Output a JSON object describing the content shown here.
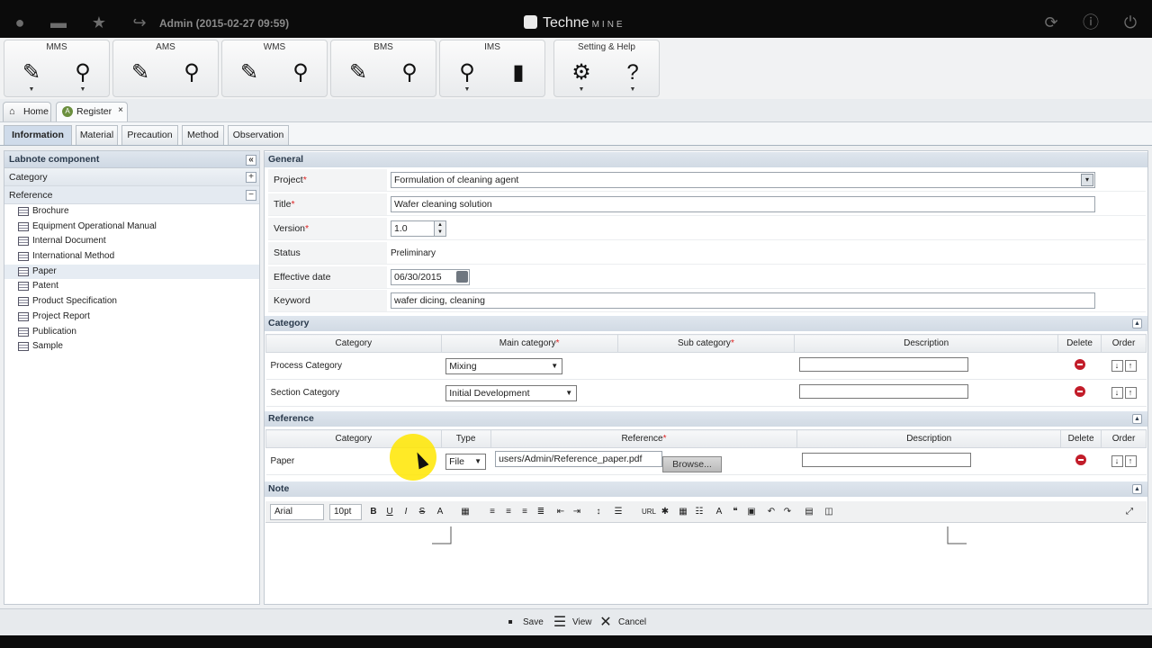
{
  "topbar": {
    "user_title": "Admin (2015-02-27 09:59)",
    "brand": "Techne",
    "brand_suffix": "MINE"
  },
  "modules": [
    {
      "title": "MMS"
    },
    {
      "title": "AMS"
    },
    {
      "title": "WMS"
    },
    {
      "title": "BMS"
    },
    {
      "title": "IMS"
    },
    {
      "title": "Setting & Help"
    }
  ],
  "page_tabs": {
    "home": "Home",
    "register": "Register"
  },
  "sub_tabs": {
    "information": "Information",
    "material": "Material",
    "precaution": "Precaution",
    "method": "Method",
    "observation": "Observation"
  },
  "left": {
    "header": "Labnote component",
    "category": "Category",
    "reference": "Reference",
    "items": [
      "Brochure",
      "Equipment Operational Manual",
      "Internal Document",
      "International Method",
      "Paper",
      "Patent",
      "Product Specification",
      "Project Report",
      "Publication",
      "Sample"
    ]
  },
  "general": {
    "header": "General",
    "project_label": "Project",
    "project_value": "Formulation of cleaning agent",
    "title_label": "Title",
    "title_value": "Wafer cleaning solution",
    "version_label": "Version",
    "version_value": "1.0",
    "status_label": "Status",
    "status_value": "Preliminary",
    "date_label": "Effective date",
    "date_value": "06/30/2015",
    "keyword_label": "Keyword",
    "keyword_value": "wafer dicing, cleaning",
    "req": "*"
  },
  "category": {
    "header": "Category",
    "columns": {
      "category": "Category",
      "main": "Main category",
      "sub": "Sub category",
      "description": "Description",
      "delete": "Delete",
      "order": "Order"
    },
    "rows": [
      {
        "category": "Process Category",
        "main": "Mixing"
      },
      {
        "category": "Section Category",
        "main": "Initial Development"
      }
    ]
  },
  "reference": {
    "header": "Reference",
    "columns": {
      "category": "Category",
      "type": "Type",
      "reference": "Reference",
      "description": "Description",
      "delete": "Delete",
      "order": "Order"
    },
    "row": {
      "category": "Paper",
      "type": "File",
      "path": "users/Admin/Reference_paper.pdf",
      "browse": "Browse..."
    }
  },
  "note": {
    "header": "Note",
    "font": "Arial",
    "size": "10pt"
  },
  "actions": {
    "save": "Save",
    "view": "View",
    "cancel": "Cancel"
  },
  "ordering": {
    "down": "↓",
    "up": "↑"
  }
}
